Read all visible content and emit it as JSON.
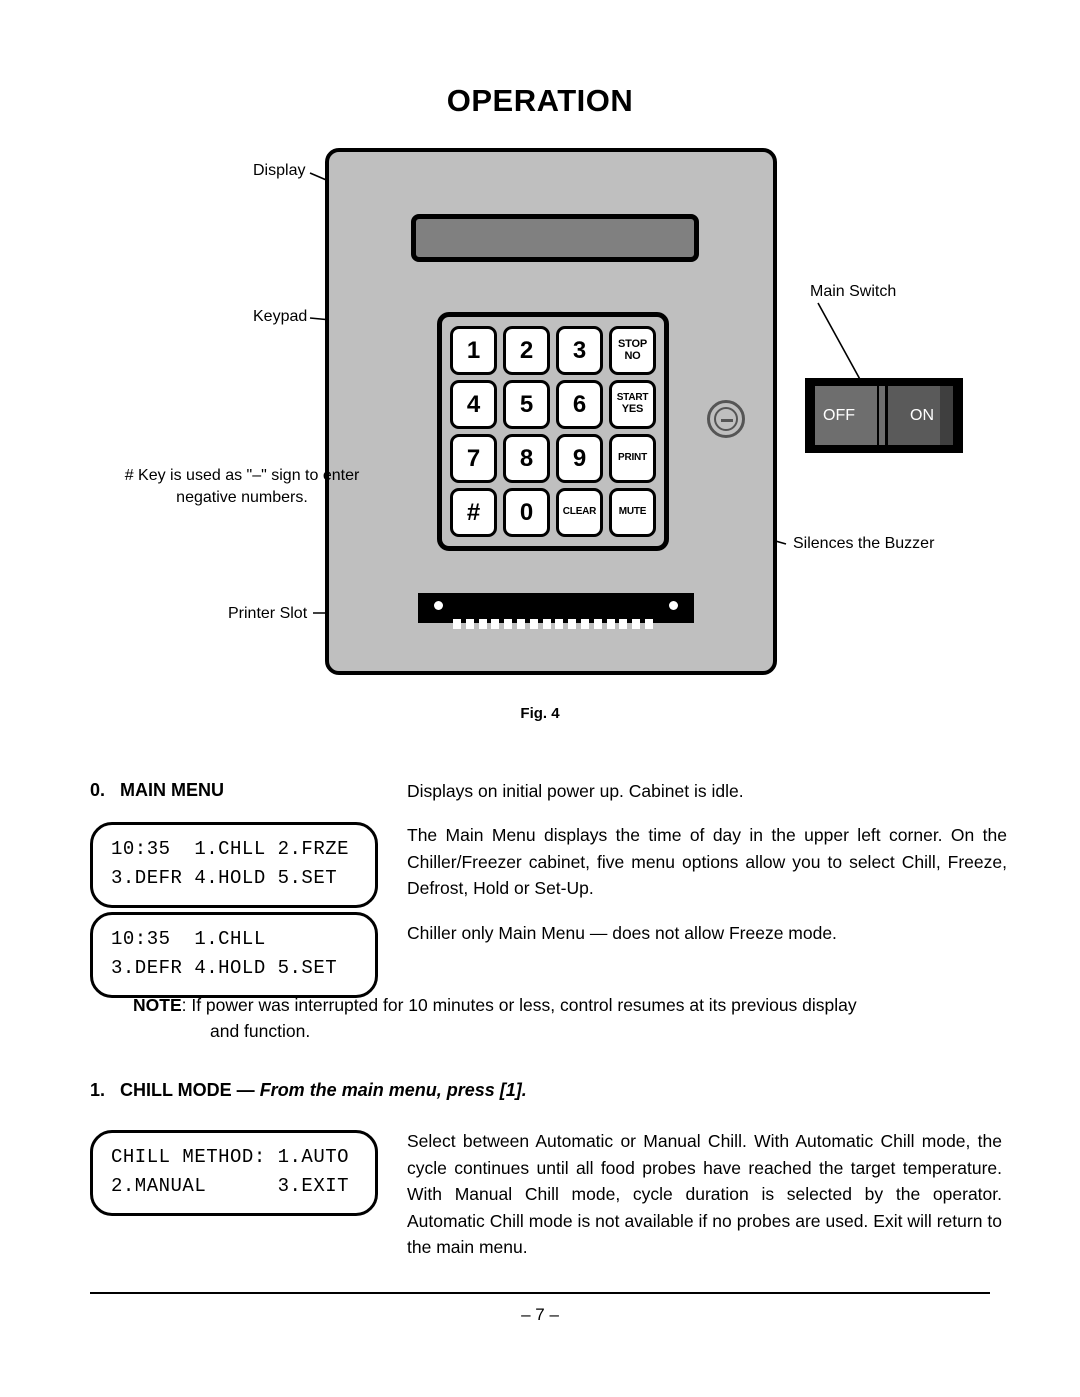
{
  "document": {
    "title": "OPERATION",
    "page_number": "– 7 –"
  },
  "figure": {
    "caption": "Fig. 4",
    "callouts": {
      "display": "Display",
      "keypad": "Keypad",
      "hash_note": "# Key is used as \"–\" sign to enter negative numbers.",
      "printer_slot": "Printer Slot",
      "main_switch": "Main Switch",
      "buzzer": "Silences the Buzzer"
    },
    "keypad": {
      "rows": [
        [
          {
            "type": "num",
            "label": "1"
          },
          {
            "type": "num",
            "label": "2"
          },
          {
            "type": "num",
            "label": "3"
          },
          {
            "type": "word",
            "line1": "STOP",
            "line2": "NO"
          }
        ],
        [
          {
            "type": "num",
            "label": "4"
          },
          {
            "type": "num",
            "label": "5"
          },
          {
            "type": "num",
            "label": "6"
          },
          {
            "type": "word",
            "line1": "START",
            "line2": "YES"
          }
        ],
        [
          {
            "type": "num",
            "label": "7"
          },
          {
            "type": "num",
            "label": "8"
          },
          {
            "type": "num",
            "label": "9"
          },
          {
            "type": "word",
            "line1": "PRINT",
            "line2": ""
          }
        ],
        [
          {
            "type": "num",
            "label": "#"
          },
          {
            "type": "num",
            "label": "0"
          },
          {
            "type": "word",
            "line1": "CLEAR",
            "line2": ""
          },
          {
            "type": "word",
            "line1": "MUTE",
            "line2": ""
          }
        ]
      ]
    },
    "main_switch": {
      "off_label": "OFF",
      "on_label": "ON"
    }
  },
  "sections": {
    "main_menu": {
      "number": "0.",
      "title": "MAIN MENU",
      "lcd_chiller_freezer": "10:35  1.CHLL 2.FRZE\n3.DEFR 4.HOLD 5.SET",
      "lcd_chiller_only": "10:35  1.CHLL\n3.DEFR 4.HOLD 5.SET",
      "para_idle": "Displays on initial power up.  Cabinet is idle.",
      "para_main_menu": "The Main Menu displays the time of day in the upper left corner. On the Chiller/Freezer cabinet, five menu options allow you to select Chill, Freeze, Defrost, Hold or Set-Up.",
      "para_chiller_only": "Chiller only Main Menu — does not allow Freeze mode.",
      "note_label": "NOTE",
      "note_text": ": If power was interrupted for 10 minutes or less, control resumes at its previous display",
      "note_text_2": "and function."
    },
    "chill_mode": {
      "number": "1.",
      "title": "CHILL MODE",
      "dash": " — ",
      "subtitle": "From the main menu, press [1].",
      "lcd_chill_method": "CHILL METHOD: 1.AUTO\n2.MANUAL      3.EXIT",
      "para_description": "Select between Automatic or Manual Chill.  With Automatic Chill mode, the cycle continues until all food probes have reached the target temperature.  With Manual Chill mode, cycle duration is selected by the operator.  Automatic Chill mode is not available if no probes are used.  Exit will return to the main menu."
    }
  }
}
